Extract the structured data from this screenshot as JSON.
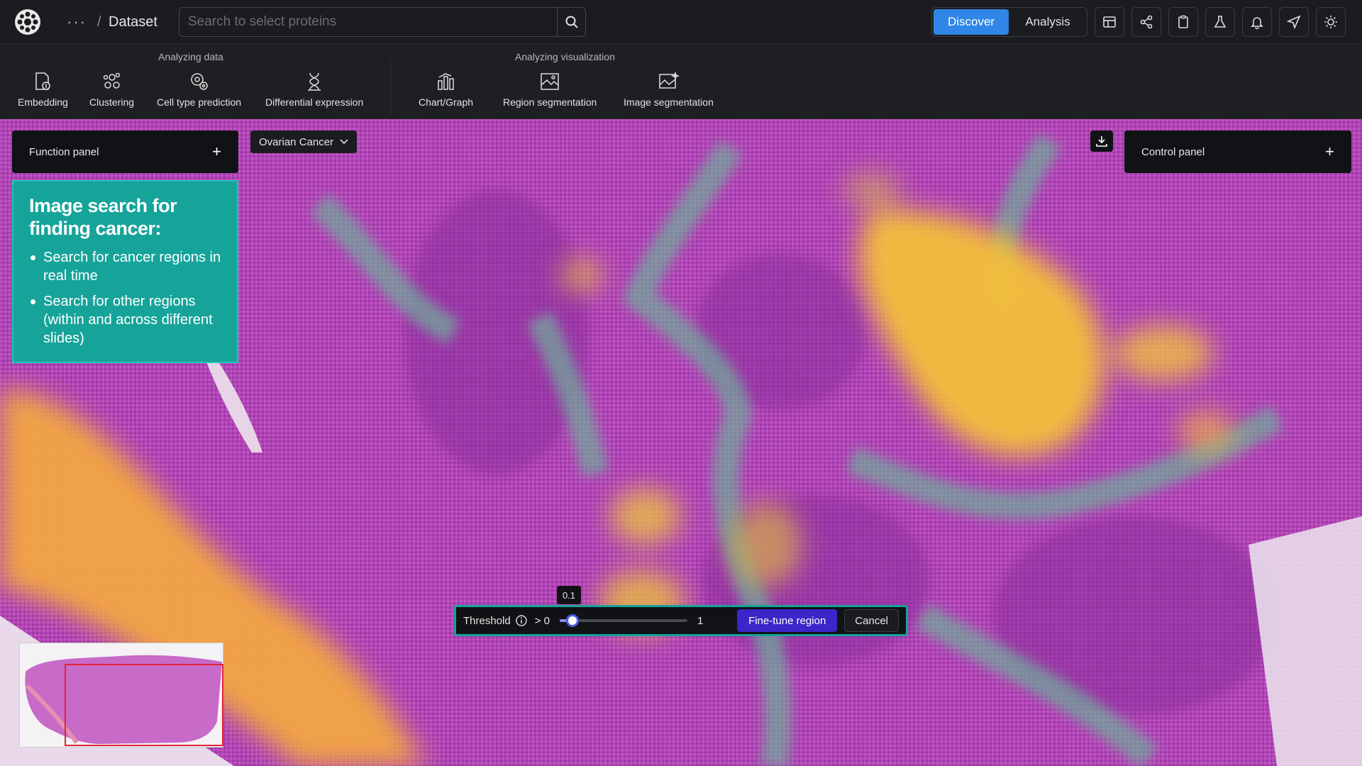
{
  "header": {
    "breadcrumb_more": "···",
    "breadcrumb_sep": "/",
    "breadcrumb_current": "Dataset",
    "search_placeholder": "Search to select proteins",
    "mode_tabs": [
      "Discover",
      "Analysis"
    ],
    "active_mode": "Discover",
    "right_icons": [
      "layout-icon",
      "share-icon",
      "clipboard-icon",
      "flask-icon",
      "bell-icon",
      "send-icon",
      "sun-icon"
    ]
  },
  "toolbar": {
    "group1_label": "Analyzing data",
    "group2_label": "Analyzing visualization",
    "tools": [
      {
        "label": "Embedding",
        "icon": "embedding-icon"
      },
      {
        "label": "Clustering",
        "icon": "clustering-icon"
      },
      {
        "label": "Cell type prediction",
        "icon": "cell-type-icon"
      },
      {
        "label": "Differential expression",
        "icon": "differential-expression-icon"
      },
      {
        "label": "Chart/Graph",
        "icon": "chart-icon"
      },
      {
        "label": "Region segmentation",
        "icon": "region-segmentation-icon"
      },
      {
        "label": "Image segmentation",
        "icon": "image-segmentation-icon"
      }
    ]
  },
  "canvas": {
    "function_panel_label": "Function panel",
    "control_panel_label": "Control panel",
    "plus": "+",
    "dataset_select": "Ovarian Cancer",
    "info_title": "Image search for finding cancer:",
    "info_points": [
      "Search for cancer regions in real time",
      "Search for other regions (within and across different slides)"
    ]
  },
  "threshold": {
    "label": "Threshold",
    "min_label": "> 0",
    "max_label": "1",
    "value": 0.1,
    "value_text": "0.1",
    "fine_tune_label": "Fine-tune region",
    "cancel_label": "Cancel"
  },
  "colors": {
    "accent_blue": "#2f86e6",
    "teal": "#16a39a",
    "primary_button": "#3a26c9",
    "tissue_magenta": "#b445b4",
    "heat_yellow": "#f2c232"
  }
}
